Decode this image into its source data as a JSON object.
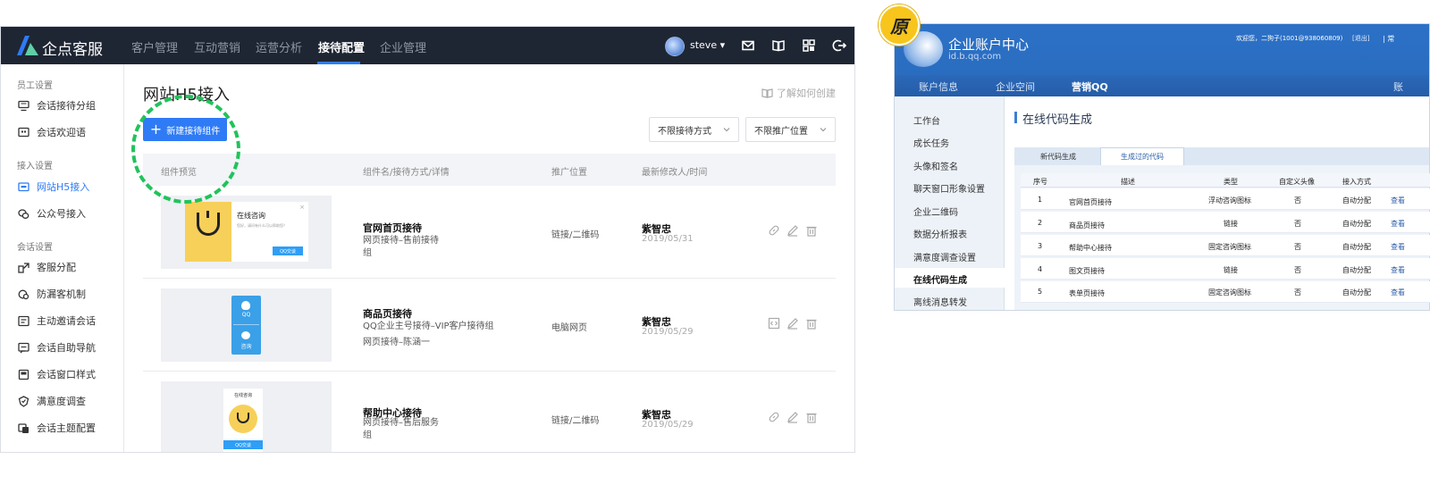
{
  "left": {
    "brand": "企点客服",
    "nav": [
      "客户管理",
      "互动营销",
      "运营分析",
      "接待配置",
      "企业管理"
    ],
    "nav_active": "接待配置",
    "user": "steve ▾",
    "sidebar": {
      "sections": [
        {
          "title": "员工设置",
          "items": [
            "会话接待分组",
            "会话欢迎语"
          ]
        },
        {
          "title": "接入设置",
          "items": [
            "网站H5接入",
            "公众号接入"
          ]
        },
        {
          "title": "会话设置",
          "items": [
            "客服分配",
            "防漏客机制",
            "主动邀请会话",
            "会话自助导航",
            "会话窗口样式",
            "满意度调查",
            "会话主题配置"
          ]
        }
      ],
      "active": "网站H5接入"
    },
    "page_title": "网站H5接入",
    "howto": "了解如何创建",
    "new_button": "新建接待组件",
    "filter_mode": "不限接待方式",
    "filter_position": "不限推广位置",
    "columns": [
      "组件预览",
      "组件名/接待方式/详情",
      "推广位置",
      "最新修改人/时间"
    ],
    "rows": [
      {
        "name": "官网首页接待",
        "detail": [
          "网页接待–售前接待",
          "组"
        ],
        "position": "链接/二维码",
        "editor": "紫智忠",
        "date": "2019/05/31"
      },
      {
        "name": "商品页接待",
        "detail": [
          "QQ企业主号接待–VIP客户接待组",
          "网页接待–陈涵一"
        ],
        "position": "电脑网页",
        "editor": "紫智忠",
        "date": "2019/05/29"
      },
      {
        "name": "帮助中心接待",
        "detail": [
          "网页接待–售后服务",
          "组"
        ],
        "position": "链接/二维码",
        "editor": "紫智忠",
        "date": "2019/05/29"
      }
    ],
    "preview1": {
      "title": "在线咨询",
      "body": "您好，请问有什么可以帮助您？",
      "btn": "QQ交谈",
      "logo": "U"
    },
    "preview2": {
      "top": "QQ",
      "bottom": "咨询"
    },
    "preview3": {
      "title": "在线咨询",
      "btn": "QQ交谈",
      "logo": "U"
    },
    "accent": "#2f7bf6",
    "highlight": "#21c35b"
  },
  "right": {
    "badge": "原",
    "logo_title": "企业账户中心",
    "logo_sub": "id.b.qq.com",
    "welcome": "欢迎您，二狗子(1001@938060809)",
    "logout": "[退出]",
    "top_right": "| 常",
    "nav": [
      "账户信息",
      "企业空间",
      "营销QQ"
    ],
    "nav_active": "营销QQ",
    "nav_right": "账",
    "sidebar": [
      "工作台",
      "成长任务",
      "头像和签名",
      "聊天窗口形象设置",
      "企业二维码",
      "数据分析报表",
      "满意度调查设置",
      "在线代码生成",
      "离线消息转发"
    ],
    "sidebar_active": "在线代码生成",
    "title": "在线代码生成",
    "tabs": [
      "新代码生成",
      "生成过的代码"
    ],
    "tab_active": "生成过的代码",
    "columns": [
      "序号",
      "描述",
      "类型",
      "自定义头像",
      "接入方式"
    ],
    "rows": [
      {
        "no": "1",
        "desc": "官网首页接待",
        "type": "浮动咨询图标",
        "avatar": "否",
        "mode": "自动分配",
        "link": "查看"
      },
      {
        "no": "2",
        "desc": "商品页接待",
        "type": "链接",
        "avatar": "否",
        "mode": "自动分配",
        "link": "查看"
      },
      {
        "no": "3",
        "desc": "帮助中心接待",
        "type": "固定咨询图标",
        "avatar": "否",
        "mode": "自动分配",
        "link": "查看"
      },
      {
        "no": "4",
        "desc": "图文页接待",
        "type": "链接",
        "avatar": "否",
        "mode": "自动分配",
        "link": "查看"
      },
      {
        "no": "5",
        "desc": "表单页接待",
        "type": "固定咨询图标",
        "avatar": "否",
        "mode": "自动分配",
        "link": "查看"
      }
    ]
  }
}
